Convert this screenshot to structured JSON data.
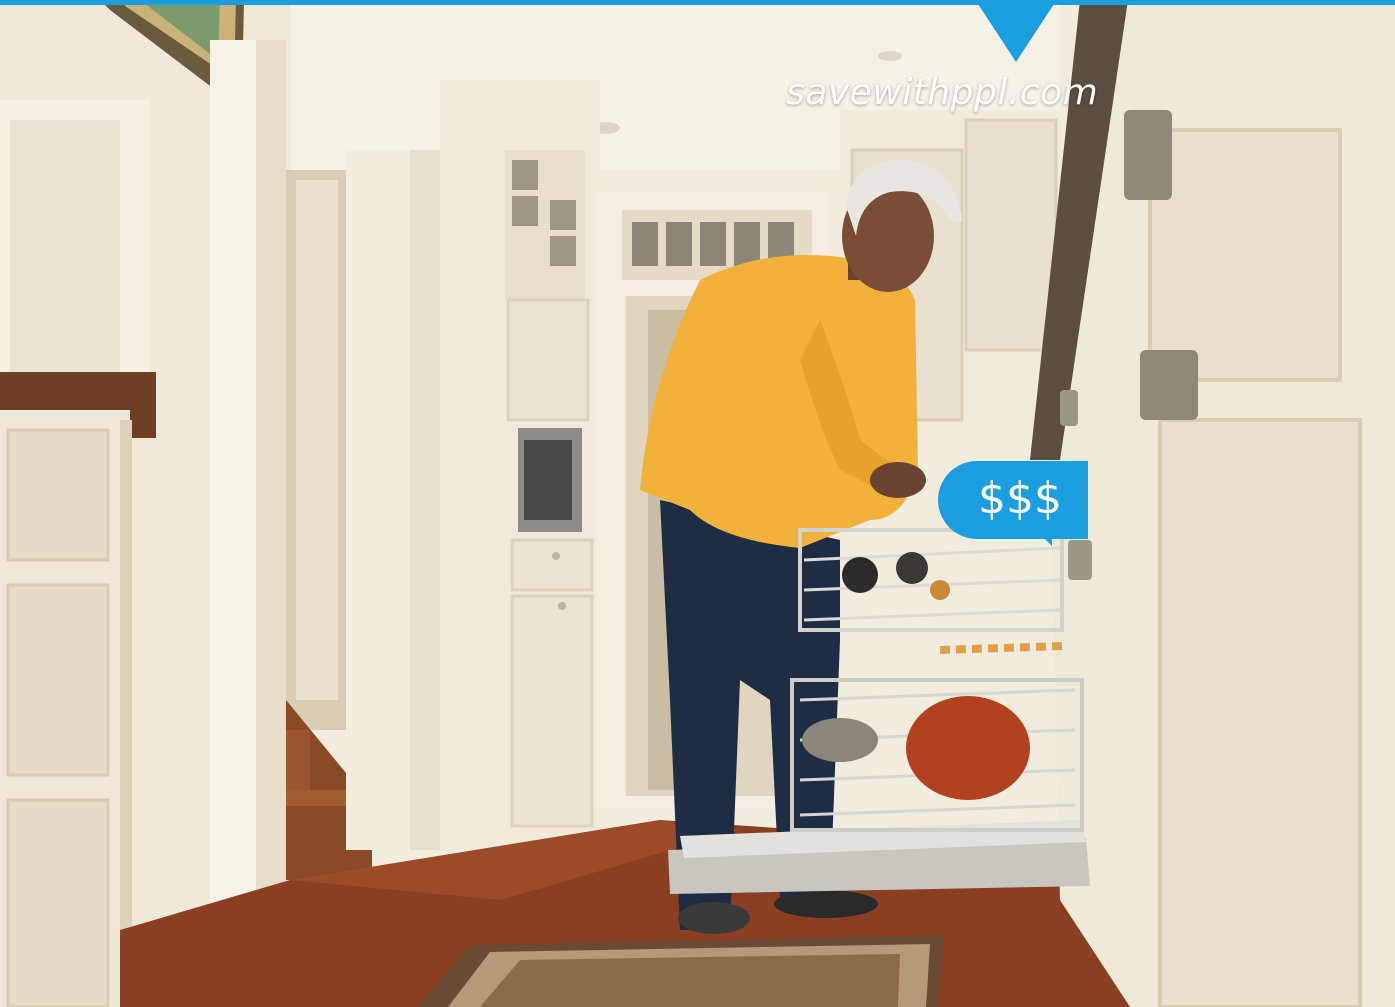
{
  "banner": {
    "url": "savewithppl.com",
    "accent_color": "#1a9ee0"
  },
  "price_bubble": {
    "text": "$$$"
  },
  "photo": {
    "wall_color": "#f1ebdd",
    "floor_color": "#8a3f22",
    "sweater_color": "#f2b13a",
    "jeans_color": "#1f2d44",
    "cabinet_color": "#efe8d6"
  }
}
